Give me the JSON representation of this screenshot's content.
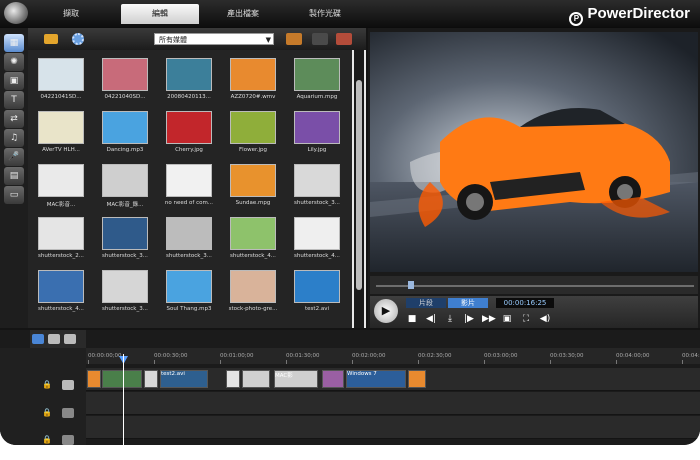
{
  "topbar": {
    "tabs": [
      "擷取",
      "編輯",
      "產出檔案",
      "製作光碟"
    ],
    "active_tab": "編輯",
    "brand": "PowerDirector",
    "brand_mark": "P"
  },
  "rail": {
    "items": [
      {
        "icon": "media-room-icon",
        "glyph": "▦",
        "active": true
      },
      {
        "icon": "effect-room-icon",
        "glyph": "✺"
      },
      {
        "icon": "pip-room-icon",
        "glyph": "▣"
      },
      {
        "icon": "title-room-icon",
        "glyph": "T"
      },
      {
        "icon": "transition-room-icon",
        "glyph": "⇄"
      },
      {
        "icon": "audio-mixer-icon",
        "glyph": "♫"
      },
      {
        "icon": "voiceover-icon",
        "glyph": "🎤"
      },
      {
        "icon": "chapter-room-icon",
        "glyph": "▤"
      },
      {
        "icon": "subtitle-room-icon",
        "glyph": "▭"
      }
    ]
  },
  "library": {
    "dropdown_value": "所有媒體",
    "items": [
      {
        "caption": "04221041SD...",
        "color": "#d7e3ea"
      },
      {
        "caption": "04221040SD...",
        "color": "#c86b7a"
      },
      {
        "caption": "20080420113...",
        "color": "#3c7f9a"
      },
      {
        "caption": "AZZ0720#.wmv",
        "color": "#e88a2f"
      },
      {
        "caption": "Aquarium.mpg",
        "color": "#5d8c5a"
      },
      {
        "caption": "AVerTV HLH...",
        "color": "#e9e4c9"
      },
      {
        "caption": "Dancing.mp3",
        "color": "#4aa3e0"
      },
      {
        "caption": "Cherry.jpg",
        "color": "#c2262b"
      },
      {
        "caption": "Flower.jpg",
        "color": "#8fae3a"
      },
      {
        "caption": "Lily.jpg",
        "color": "#7a4fa8"
      },
      {
        "caption": "MAC影音...",
        "color": "#eaeaea"
      },
      {
        "caption": "MAC影音_錄...",
        "color": "#cfcfcf"
      },
      {
        "caption": "no need of com...",
        "color": "#f1f1f1"
      },
      {
        "caption": "Sundae.mpg",
        "color": "#e8922d"
      },
      {
        "caption": "shutterstock_3...",
        "color": "#d9d9d9"
      },
      {
        "caption": "shutterstock_2...",
        "color": "#e5e5e5"
      },
      {
        "caption": "shutterstock_3...",
        "color": "#2f5a8a"
      },
      {
        "caption": "shutterstock_3...",
        "color": "#bcbcbc"
      },
      {
        "caption": "shutterstock_4...",
        "color": "#8ec26b"
      },
      {
        "caption": "shutterstock_4...",
        "color": "#efefef"
      },
      {
        "caption": "shutterstock_4...",
        "color": "#3a6fb0"
      },
      {
        "caption": "shutterstock_3...",
        "color": "#d6d6d6"
      },
      {
        "caption": "Soul Thang.mp3",
        "color": "#4aa3e0"
      },
      {
        "caption": "stock-photo-gre...",
        "color": "#d9b39a"
      },
      {
        "caption": "test2.avi",
        "color": "#2c7fc9"
      }
    ]
  },
  "preview": {
    "mode_clip": "片段",
    "mode_movie": "影片",
    "timecode": "00:00:16:25",
    "seek": 0.1,
    "controls": [
      {
        "name": "stop-icon",
        "glyph": "■"
      },
      {
        "name": "step-back-icon",
        "glyph": "◀|"
      },
      {
        "name": "snapshot-icon",
        "glyph": "⤓"
      },
      {
        "name": "step-forward-icon",
        "glyph": "|▶"
      },
      {
        "name": "fast-forward-icon",
        "glyph": "▶▶"
      },
      {
        "name": "preview-mode-icon",
        "glyph": "▣"
      },
      {
        "name": "fullscreen-icon",
        "glyph": "⛶"
      },
      {
        "name": "volume-icon",
        "glyph": "◀)"
      }
    ]
  },
  "timeline": {
    "ruler": [
      "00:00:00;00",
      "00:00:30;00",
      "00:01:00;00",
      "00:01:30;00",
      "00:02:00;00",
      "00:02:30;00",
      "00:03:00;00",
      "00:03:30;00",
      "00:04:00;00",
      "00:04:30"
    ],
    "clips": [
      {
        "label": "",
        "color": "#e88a2f"
      },
      {
        "label": "",
        "color": "#4a7f4a"
      },
      {
        "label": "",
        "color": "#d8d8d8"
      },
      {
        "label": "test2.avi",
        "color": "#2e5f8f"
      },
      {
        "label": "",
        "color": "#e5e5e5"
      },
      {
        "label": "",
        "color": "#d0d0d0"
      },
      {
        "label": "MAC影",
        "color": "#cfcfcf"
      },
      {
        "label": "",
        "color": "#9a5fa3"
      },
      {
        "label": "Windows 7",
        "color": "#2c5e9a"
      },
      {
        "label": "",
        "color": "#e88a2f"
      }
    ]
  }
}
